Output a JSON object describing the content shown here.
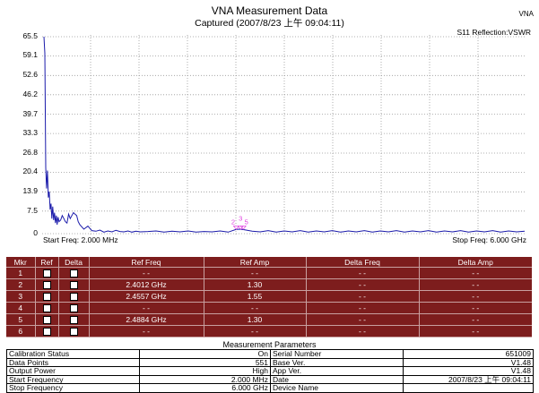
{
  "header": {
    "title": "VNA Measurement Data",
    "subtitle": "Captured  (2007/8/23 上午 09:04:11)",
    "app_tag": "VNA",
    "mode": "S11 Reflection:VSWR"
  },
  "chart_data": {
    "type": "line",
    "title": "VNA Measurement Data",
    "ylim": [
      0,
      65.5
    ],
    "y_ticks": [
      "65.5",
      "59.1",
      "52.6",
      "46.2",
      "39.7",
      "33.3",
      "26.8",
      "20.4",
      "13.9",
      "7.5",
      "0"
    ],
    "x_range_ghz": [
      0.002,
      6.0
    ],
    "start_label": "Start Freq: 2.000 MHz",
    "stop_label": "Stop Freq: 6.000 GHz",
    "grid": true,
    "color": "#1a1aaa",
    "marker_color": "#e040e0",
    "series": [
      {
        "x": [
          0.002,
          0.013,
          0.024,
          0.035,
          0.046,
          0.057,
          0.068,
          0.079,
          0.09,
          0.101,
          0.112,
          0.123,
          0.134,
          0.145,
          0.156,
          0.167,
          0.178,
          0.19,
          0.21,
          0.23,
          0.25,
          0.27,
          0.29,
          0.31,
          0.33,
          0.35,
          0.37,
          0.39,
          0.41,
          0.43,
          0.45,
          0.5,
          0.55,
          0.6,
          0.65,
          0.7,
          0.75,
          0.8,
          0.85,
          0.9,
          0.95,
          1.0,
          1.05,
          1.1,
          1.15,
          1.2,
          1.3,
          1.4,
          1.5,
          1.6,
          1.7,
          1.8,
          1.9,
          2.0,
          2.1,
          2.2,
          2.3,
          2.4,
          2.45,
          2.5,
          2.6,
          2.7,
          2.8,
          2.9,
          3.0,
          3.1,
          3.2,
          3.3,
          3.4,
          3.5,
          3.6,
          3.7,
          3.8,
          3.9,
          4.0,
          4.1,
          4.2,
          4.3,
          4.4,
          4.5,
          4.6,
          4.7,
          4.8,
          4.9,
          5.0,
          5.1,
          5.2,
          5.3,
          5.4,
          5.5,
          5.6,
          5.7,
          5.8,
          5.9,
          6.0
        ],
        "y": [
          65.5,
          60,
          22,
          15,
          21,
          12,
          14,
          8,
          10,
          5,
          9,
          4.5,
          7,
          3.5,
          6,
          3,
          5.5,
          4,
          4.5,
          6,
          5,
          4,
          3.5,
          6.5,
          5,
          6,
          7,
          6.5,
          6,
          4,
          3,
          1.5,
          2.5,
          1,
          0.8,
          1.2,
          0.5,
          0.9,
          0.6,
          1.1,
          0.7,
          0.6,
          0.9,
          0.5,
          0.8,
          0.6,
          0.7,
          0.9,
          0.5,
          0.8,
          0.6,
          0.9,
          0.5,
          0.7,
          0.6,
          0.9,
          0.5,
          1.4,
          1.5,
          1.3,
          0.8,
          0.6,
          1.0,
          0.5,
          0.9,
          0.6,
          1.0,
          0.5,
          0.9,
          0.6,
          1.0,
          0.5,
          0.9,
          0.6,
          1.0,
          0.5,
          0.9,
          0.6,
          1.0,
          0.5,
          0.9,
          0.6,
          1.0,
          0.5,
          0.9,
          0.6,
          1.0,
          0.5,
          0.9,
          0.6,
          1.0,
          0.5,
          0.9,
          0.6,
          0.8
        ]
      }
    ],
    "markers": [
      {
        "label": "2",
        "x": 2.4012
      },
      {
        "label": "3",
        "x": 2.4557
      },
      {
        "label": "5",
        "x": 2.4884
      }
    ]
  },
  "marker_table": {
    "headers": [
      "Mkr",
      "Ref",
      "Delta",
      "Ref Freq",
      "Ref Amp",
      "Delta Freq",
      "Delta Amp"
    ],
    "rows": [
      {
        "mkr": "1",
        "ref_freq": "- -",
        "ref_amp": "- -",
        "delta_freq": "- -",
        "delta_amp": "- -"
      },
      {
        "mkr": "2",
        "ref_freq": "2.4012 GHz",
        "ref_amp": "1.30",
        "delta_freq": "- -",
        "delta_amp": "- -"
      },
      {
        "mkr": "3",
        "ref_freq": "2.4557 GHz",
        "ref_amp": "1.55",
        "delta_freq": "- -",
        "delta_amp": "- -"
      },
      {
        "mkr": "4",
        "ref_freq": "- -",
        "ref_amp": "- -",
        "delta_freq": "- -",
        "delta_amp": "- -"
      },
      {
        "mkr": "5",
        "ref_freq": "2.4884 GHz",
        "ref_amp": "1.30",
        "delta_freq": "- -",
        "delta_amp": "- -"
      },
      {
        "mkr": "6",
        "ref_freq": "- -",
        "ref_amp": "- -",
        "delta_freq": "- -",
        "delta_amp": "- -"
      }
    ]
  },
  "params": {
    "title": "Measurement Parameters",
    "rows": [
      {
        "l1": "Calibration Status",
        "v1": "On",
        "l2": "Serial Number",
        "v2": "651009"
      },
      {
        "l1": "Data Points",
        "v1": "551",
        "l2": "Base Ver.",
        "v2": "V1.48"
      },
      {
        "l1": "Output Power",
        "v1": "High",
        "l2": "App Ver.",
        "v2": "V1.48"
      },
      {
        "l1": "Start Frequency",
        "v1": "2.000 MHz",
        "l2": "Date",
        "v2": "2007/8/23 上午 09:04:11"
      },
      {
        "l1": "Stop Frequency",
        "v1": "6.000 GHz",
        "l2": "Device Name",
        "v2": ""
      }
    ]
  }
}
